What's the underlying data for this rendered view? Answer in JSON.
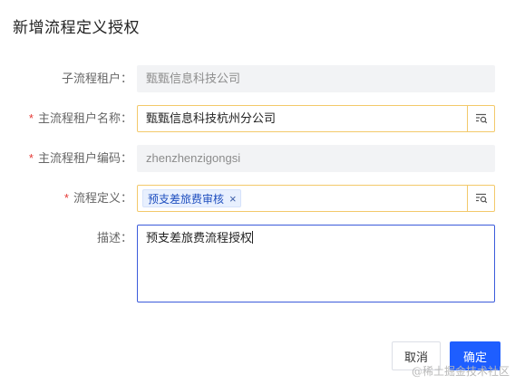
{
  "dialog": {
    "title": "新增流程定义授权"
  },
  "form": {
    "sub_tenant": {
      "label": "子流程租户：",
      "value": "甄甄信息科技公司"
    },
    "main_tenant_name": {
      "label": "主流程租户名称：",
      "value": "甄甄信息科技杭州分公司",
      "required": "*"
    },
    "main_tenant_code": {
      "label": "主流程租户编码：",
      "value": "zhenzhenzigongsi",
      "required": "*"
    },
    "process_def": {
      "label": "流程定义：",
      "tag": "预支差旅费审核",
      "tag_close": "×",
      "required": "*"
    },
    "description": {
      "label": "描述：",
      "value": "预支差旅费流程授权"
    }
  },
  "actions": {
    "cancel": "取消",
    "confirm": "确定"
  },
  "watermark": "@稀土掘金技术社区",
  "colors": {
    "accent": "#1e5eff",
    "focus_border": "#3b5bdb",
    "lookup_border": "#f3c96a",
    "required": "#e53935"
  },
  "icons": {
    "lookup": "search-list-icon",
    "tag_close": "close-icon"
  }
}
